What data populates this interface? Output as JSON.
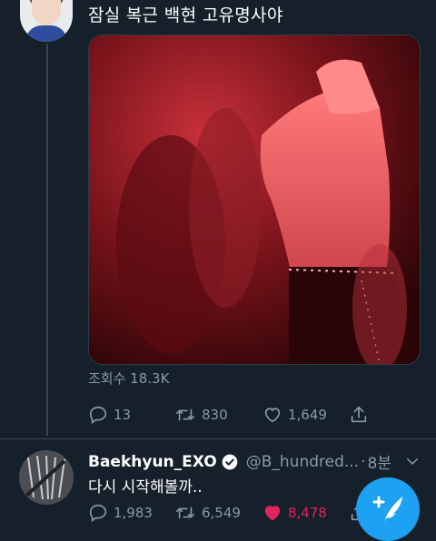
{
  "tweet1": {
    "text": "잠실 복근 백현 고유명사야",
    "views": "조회수 18.3K",
    "replies": "13",
    "retweets": "830",
    "likes": "1,649"
  },
  "tweet2": {
    "display_name": "Baekhyun_EXO",
    "handle": "@B_hundred...",
    "separator": "·",
    "time": "8분",
    "text": "다시 시작해볼까..",
    "replies": "1,983",
    "retweets": "6,549",
    "likes": "8,478",
    "liked": true
  },
  "colors": {
    "background": "#15202b",
    "secondary_text": "#8899a6",
    "accent": "#1da1f2",
    "like": "#e0245e"
  },
  "icons": {
    "reply": "reply-icon",
    "retweet": "retweet-icon",
    "like": "heart-icon",
    "share": "share-icon",
    "verified": "verified-badge-icon",
    "more": "chevron-down-icon",
    "compose": "compose-tweet-icon"
  }
}
